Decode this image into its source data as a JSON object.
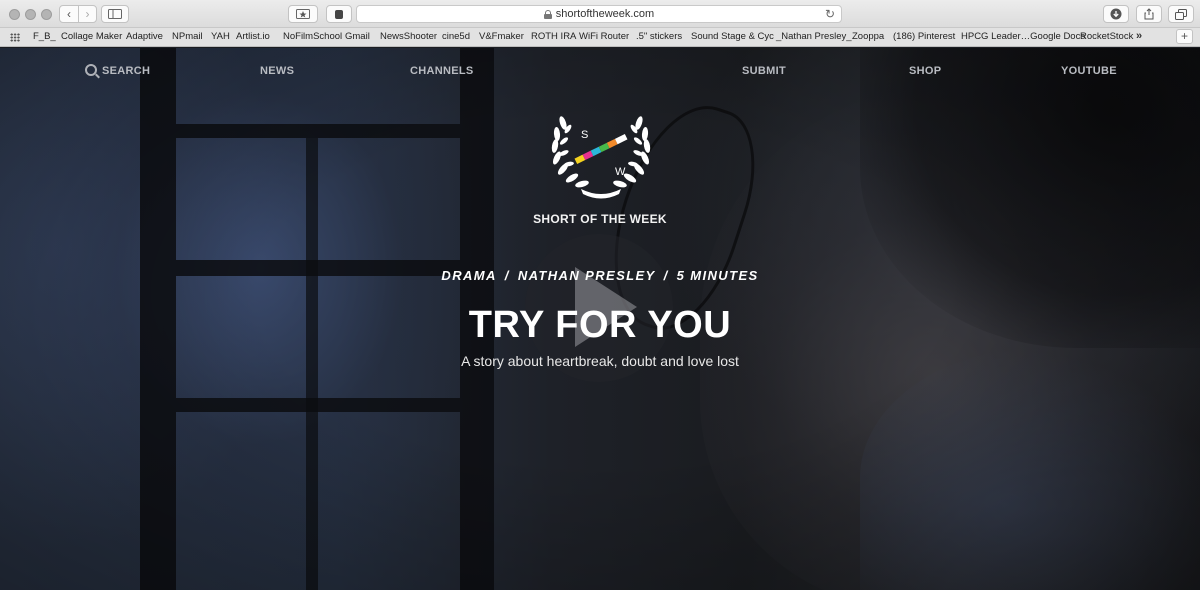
{
  "browser": {
    "url": "shortoftheweek.com",
    "bookmarks": [
      "F_B_",
      "Collage Maker",
      "Adaptive",
      "NPmail",
      "YAH",
      "Artlist.io",
      "NoFilmSchool",
      "Gmail",
      "NewsShooter",
      "cine5d",
      "V&Fmaker",
      "ROTH IRA",
      "WiFi Router",
      ".5\" stickers",
      "Sound Stage & Cyc",
      "_Nathan Presley_",
      "Zooppa",
      "(186) Pinterest",
      "HPCG Leader…Google Docs",
      "RocketStock"
    ],
    "icons": [
      "back-icon",
      "forward-icon",
      "sidebar-icon",
      "reader-icon",
      "extension-icon",
      "lock-icon",
      "reload-icon",
      "download-icon",
      "share-icon",
      "tabs-icon",
      "grid-icon",
      "more-icon",
      "new-tab-icon"
    ]
  },
  "nav": {
    "search": "SEARCH",
    "news": "NEWS",
    "channels": "CHANNELS",
    "submit": "SUBMIT",
    "shop": "SHOP",
    "youtube": "YOUTUBE"
  },
  "logo": {
    "letter_top": "S",
    "letter_bottom": "W",
    "name": "SHORT OF THE WEEK",
    "stripe_colors": [
      "#f5d21f",
      "#e8318e",
      "#2bb7d9",
      "#47b94a",
      "#f18a2b",
      "#ffffff"
    ]
  },
  "film": {
    "genre": "DRAMA",
    "director": "NATHAN PRESLEY",
    "duration": "5 MINUTES",
    "separator": "/",
    "title": "TRY FOR YOU",
    "tagline": "A story about heartbreak, doubt and love lost"
  }
}
